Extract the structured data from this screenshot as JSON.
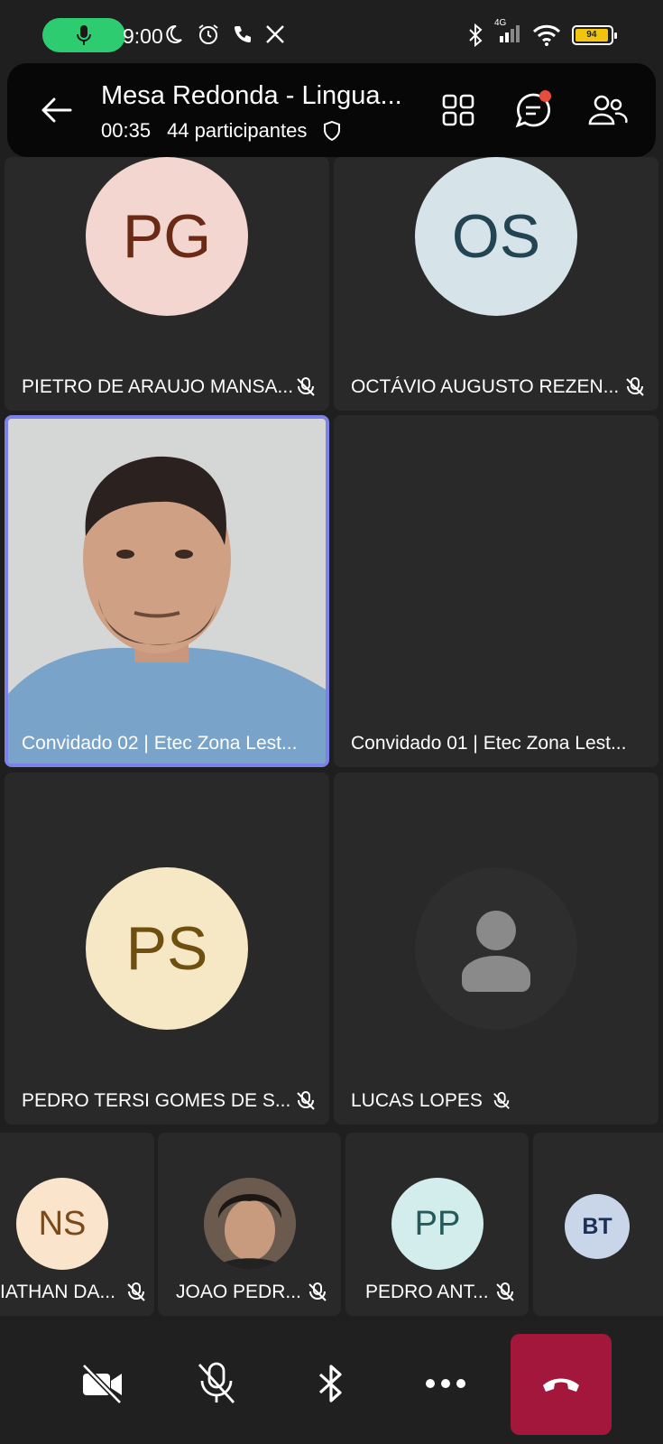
{
  "status_bar": {
    "time": "9:00",
    "network": "4G",
    "battery": "94"
  },
  "header": {
    "title": "Mesa Redonda - Lingua...",
    "duration": "00:35",
    "participants": "44 participantes"
  },
  "tiles": [
    {
      "name": "PIETRO DE ARAUJO MANSA...",
      "initials": "PG",
      "bg": "#f3d6cf",
      "fg": "#6a2a15",
      "muted": true
    },
    {
      "name": "OCTÁVIO AUGUSTO REZEN...",
      "initials": "OS",
      "bg": "#d6e4ea",
      "fg": "#234452",
      "muted": true
    },
    {
      "name": "Convidado 02 | Etec Zona Lest...",
      "video": true
    },
    {
      "name": "Convidado 01 | Etec Zona Lest..."
    },
    {
      "name": "PEDRO TERSI GOMES DE S...",
      "initials": "PS",
      "bg": "#f6e8c5",
      "fg": "#6f4f10",
      "muted": true
    },
    {
      "name": "LUCAS LOPES",
      "muted": true
    }
  ],
  "small_tiles": [
    {
      "name": "IATHAN DA...",
      "initials": "NS",
      "bg": "#fbe4cc",
      "fg": "#7a4a1a"
    },
    {
      "name": "JOAO PEDR..."
    },
    {
      "name": "PEDRO ANT...",
      "initials": "PP",
      "bg": "#d3ecec",
      "fg": "#245a5a"
    },
    {
      "initials": "BT",
      "bg": "#c9d6ea",
      "fg": "#1c2f55"
    }
  ],
  "colors": {
    "accent": "#7b83eb",
    "end_call": "#a4173c",
    "notification": "#e74c3c"
  }
}
